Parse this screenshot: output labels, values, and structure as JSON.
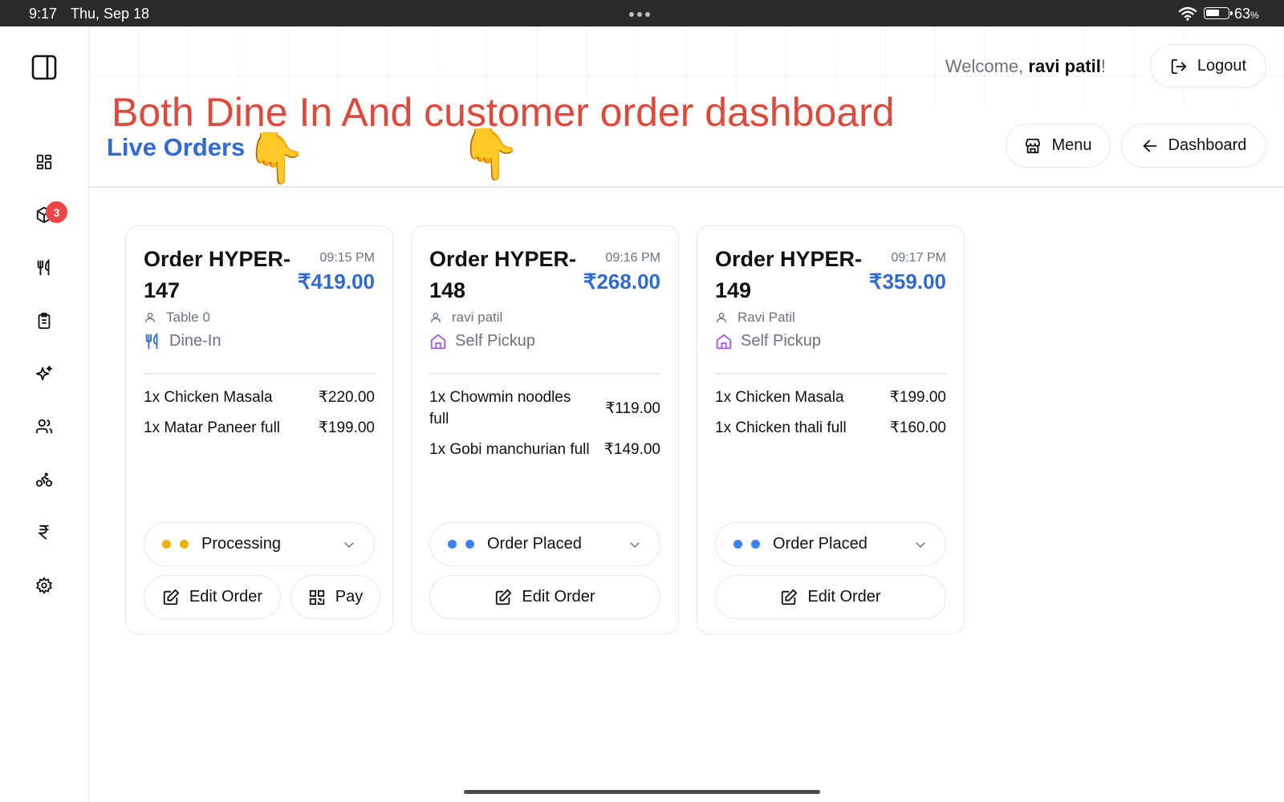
{
  "status_bar": {
    "time": "9:17",
    "date": "Thu, Sep 18",
    "battery_percent": "63",
    "battery_unit": "%",
    "battery_level": 0.63
  },
  "sidebar": {
    "badge_count": "3",
    "items": [
      {
        "icon": "dashboard-grid-icon"
      },
      {
        "icon": "orders-box-icon"
      },
      {
        "icon": "utensils-icon"
      },
      {
        "icon": "clipboard-list-icon"
      },
      {
        "icon": "sparkles-icon"
      },
      {
        "icon": "users-icon"
      },
      {
        "icon": "bike-icon"
      },
      {
        "icon": "rupee-icon"
      },
      {
        "icon": "settings-gear-icon"
      }
    ]
  },
  "header": {
    "welcome_prefix": "Welcome, ",
    "user_name": "ravi patil",
    "welcome_suffix": "!",
    "logout_label": "Logout",
    "menu_label": "Menu",
    "dashboard_label": "Dashboard",
    "annotation": "Both Dine In And customer order dashboard",
    "page_title": "Live Orders",
    "pointer_emoji": "👇"
  },
  "orders": [
    {
      "title": "Order HYPER-147",
      "time": "09:15 PM",
      "total": "₹419.00",
      "customer": "Table 0",
      "type": "Dine-In",
      "type_icon": "utensils-icon",
      "items": [
        {
          "name": "1x Chicken Masala",
          "price": "₹220.00"
        },
        {
          "name": "1x Matar Paneer full",
          "price": "₹199.00"
        }
      ],
      "status": "Processing",
      "status_color": "#eab308",
      "edit_label": "Edit Order",
      "pay_label": "Pay"
    },
    {
      "title": "Order HYPER-148",
      "time": "09:16 PM",
      "total": "₹268.00",
      "customer": "ravi patil",
      "type": "Self Pickup",
      "type_icon": "store-icon",
      "items": [
        {
          "name": "1x Chowmin noodles full",
          "price": "₹119.00"
        },
        {
          "name": "1x Gobi manchurian full",
          "price": "₹149.00"
        }
      ],
      "status": "Order Placed",
      "status_color": "#3b82f6",
      "edit_label": "Edit Order"
    },
    {
      "title": "Order HYPER-149",
      "time": "09:17 PM",
      "total": "₹359.00",
      "customer": "Ravi Patil",
      "type": "Self Pickup",
      "type_icon": "store-icon",
      "items": [
        {
          "name": "1x Chicken Masala",
          "price": "₹199.00"
        },
        {
          "name": "1x Chicken thali full",
          "price": "₹160.00"
        }
      ],
      "status": "Order Placed",
      "status_color": "#3b82f6",
      "edit_label": "Edit Order"
    }
  ],
  "colors": {
    "accent": "#2f6bd3",
    "annotation": "#e0483a",
    "badge": "#ef4444",
    "dine_in_icon": "#2f6bd3",
    "pickup_icon": "#a855f7"
  }
}
